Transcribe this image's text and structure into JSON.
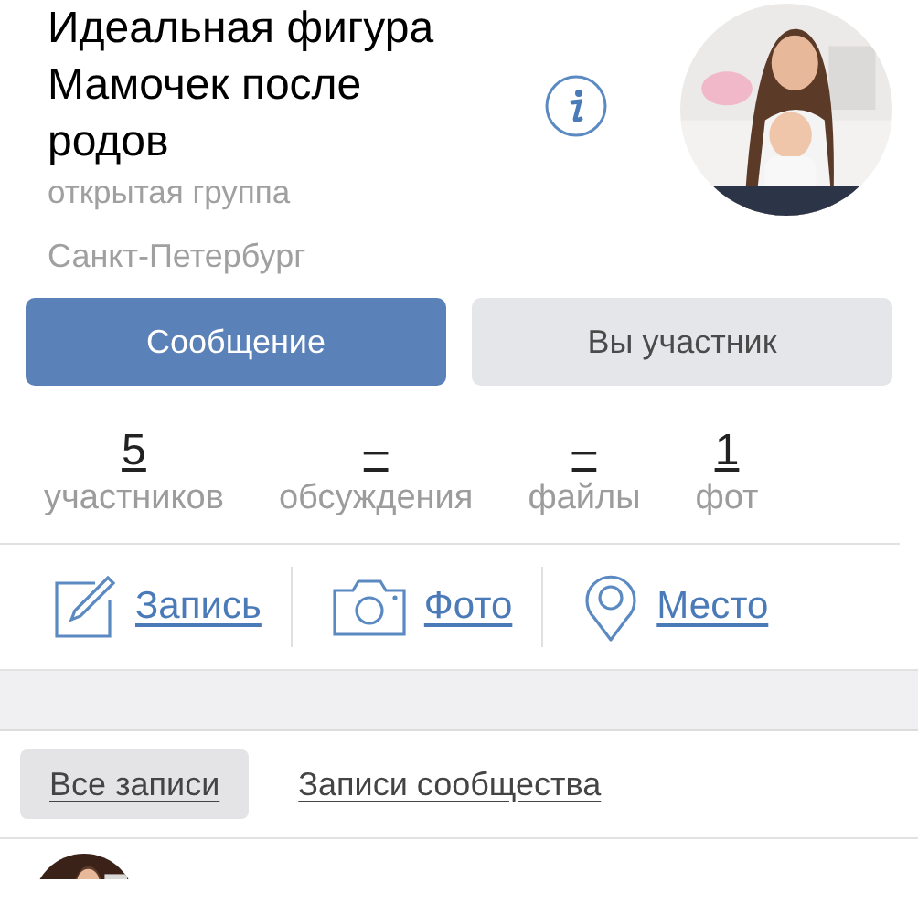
{
  "group": {
    "title": "Идеальная фигура Мамочек после родов",
    "type": "открытая группа",
    "city": "Санкт-Петербург"
  },
  "buttons": [
    {
      "label": "Сообщение",
      "kind": "primary"
    },
    {
      "label": "Вы участник",
      "kind": "secondary"
    }
  ],
  "stats": [
    {
      "value": "5",
      "label": "участников"
    },
    {
      "value": "–",
      "label": "обсуждения"
    },
    {
      "value": "–",
      "label": "файлы"
    },
    {
      "value": "1",
      "label": "фот"
    }
  ],
  "actions": [
    {
      "label": "Запись",
      "kind": "post"
    },
    {
      "label": "Фото"
    },
    {
      "label": "Место",
      "kind": "place"
    }
  ],
  "tabs": [
    {
      "label": "Все записи",
      "selected": true
    },
    {
      "label": "Записи сообщества",
      "selected": false
    }
  ]
}
